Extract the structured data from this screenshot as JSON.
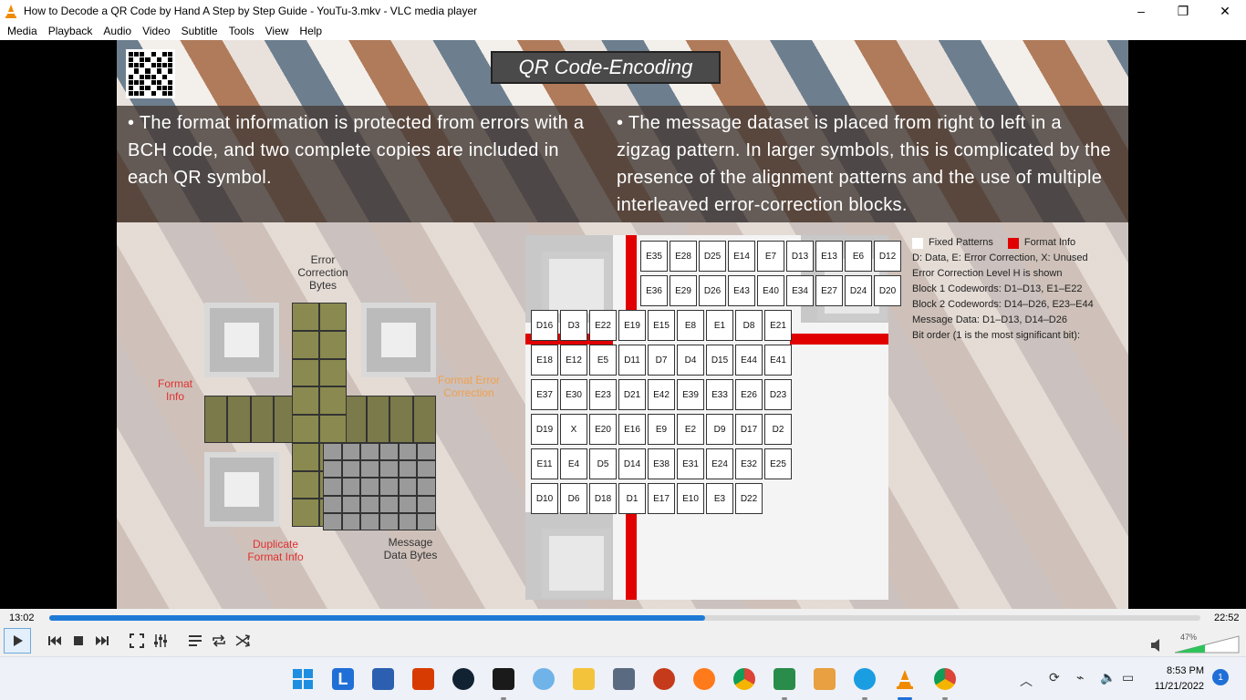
{
  "window": {
    "title": "How to Decode a QR Code by Hand A Step by Step Guide - YouTu-3.mkv - VLC media player",
    "minimize": "–",
    "maximize": "❐",
    "close": "✕"
  },
  "menu": [
    "Media",
    "Playback",
    "Audio",
    "Video",
    "Subtitle",
    "Tools",
    "View",
    "Help"
  ],
  "slide": {
    "title": "QR Code-Encoding",
    "bullet_left": "The format information is protected from errors with a BCH code, and two complete copies are included in each QR symbol.",
    "bullet_right": "The message dataset is placed from right to left in a zigzag pattern. In larger symbols, this is complicated by the presence of the alignment patterns and the use of multiple interleaved error-correction blocks.",
    "left_labels": {
      "error_correction_bytes": "Error Correction Bytes",
      "format_info": "Format Info",
      "format_error_correction": "Format Error Correction",
      "duplicate_format_info": "Duplicate Format Info",
      "message_data_bytes": "Message Data Bytes"
    },
    "legend": {
      "fixed_patterns": "Fixed Patterns",
      "format_info": "Format Info",
      "lines": [
        "D: Data, E: Error Correction, X: Unused",
        "Error Correction Level H is shown",
        "Block 1 Codewords: D1–D13, E1–E22",
        "Block 2 Codewords: D14–D26, E23–E44",
        "Message Data: D1–D13, D14–D26",
        "Bit order (1 is the most significant bit):"
      ],
      "colors": {
        "fixed": "#ffffff",
        "format": "#e00000"
      }
    },
    "codewords": [
      "E35",
      "E28",
      "D25",
      "E14",
      "E7",
      "D13",
      "E13",
      "E6",
      "D12",
      "E36",
      "E29",
      "D26",
      "E43",
      "E40",
      "E34",
      "E27",
      "D24",
      "D20",
      "D16",
      "D3",
      "E22",
      "E19",
      "E15",
      "E8",
      "E1",
      "D8",
      "E21",
      "E18",
      "E12",
      "E5",
      "D11",
      "D7",
      "D4",
      "D15",
      "E44",
      "E41",
      "E37",
      "E30",
      "E23",
      "D21",
      "E42",
      "E39",
      "E33",
      "E26",
      "D23",
      "D19",
      "X",
      "E20",
      "E16",
      "E9",
      "E2",
      "D9",
      "D17",
      "D2",
      "E11",
      "E4",
      "D5",
      "D14",
      "E38",
      "E31",
      "E24",
      "E32",
      "E25",
      "D10",
      "D6",
      "D18",
      "D1",
      "E17",
      "E10",
      "E3",
      "D22"
    ]
  },
  "player": {
    "elapsed": "13:02",
    "total": "22:52",
    "progress_fraction": 0.57,
    "volume": "47%"
  },
  "taskbar": {
    "time": "8:53 PM",
    "date": "11/21/2022",
    "notifications": "1"
  }
}
